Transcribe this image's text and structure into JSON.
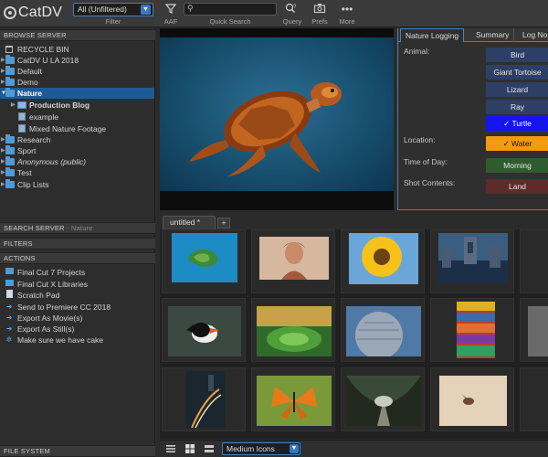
{
  "toolbar": {
    "logo": "CatDV",
    "filter_value": "All (Unfiltered)",
    "filter_label": "Filter",
    "aaf_label": "AAF",
    "search_placeholder": "",
    "search_label": "Quick Search",
    "query_label": "Query",
    "prefs_label": "Prefs",
    "more_label": "More"
  },
  "left": {
    "browse_header": "BROWSE SERVER",
    "tree": [
      {
        "label": "RECYCLE BIN"
      },
      {
        "label": "CatDV U LA 2018"
      },
      {
        "label": "Default"
      },
      {
        "label": "Demo"
      },
      {
        "label": "Nature"
      },
      {
        "label": "Production Blog"
      },
      {
        "label": "example"
      },
      {
        "label": "Mixed Nature Footage"
      },
      {
        "label": "Research"
      },
      {
        "label": "Sport"
      },
      {
        "label": "Anonymous (public)"
      },
      {
        "label": "Test"
      },
      {
        "label": "Clip Lists"
      }
    ],
    "search_header": "SEARCH SERVER",
    "search_header_sub": " - Nature",
    "filters_header": "FILTERS",
    "actions_header": "ACTIONS",
    "actions": [
      {
        "label": "Final Cut 7 Projects"
      },
      {
        "label": "Final Cut X Libraries"
      },
      {
        "label": "Scratch Pad"
      },
      {
        "label": "Send to Premiere CC 2018"
      },
      {
        "label": "Export As Movie(s)"
      },
      {
        "label": "Export As Still(s)"
      },
      {
        "label": "Make sure we have cake"
      }
    ],
    "filesystem_header": "FILE SYSTEM"
  },
  "logging": {
    "tabs": [
      "Nature Logging",
      "Summary",
      "Log No"
    ],
    "animal_label": "Animal:",
    "animal_options": [
      "Bird",
      "Giant Tortoise",
      "Lizard",
      "Ray",
      "Turtle"
    ],
    "animal_selected": "✓ Turtle",
    "location_label": "Location:",
    "location_value": "✓ Water",
    "time_label": "Time of Day:",
    "time_value": "Morning",
    "shot_label": "Shot Contents:",
    "shot_value": "Land"
  },
  "clips": {
    "tab_label": "untitled *",
    "add_tab": "+",
    "view_mode": "Medium Icons"
  },
  "colors": {
    "accent": "#4a7fb8",
    "selected": "#1e5a96",
    "turtle": "#1414f0",
    "water": "#f39a10"
  }
}
